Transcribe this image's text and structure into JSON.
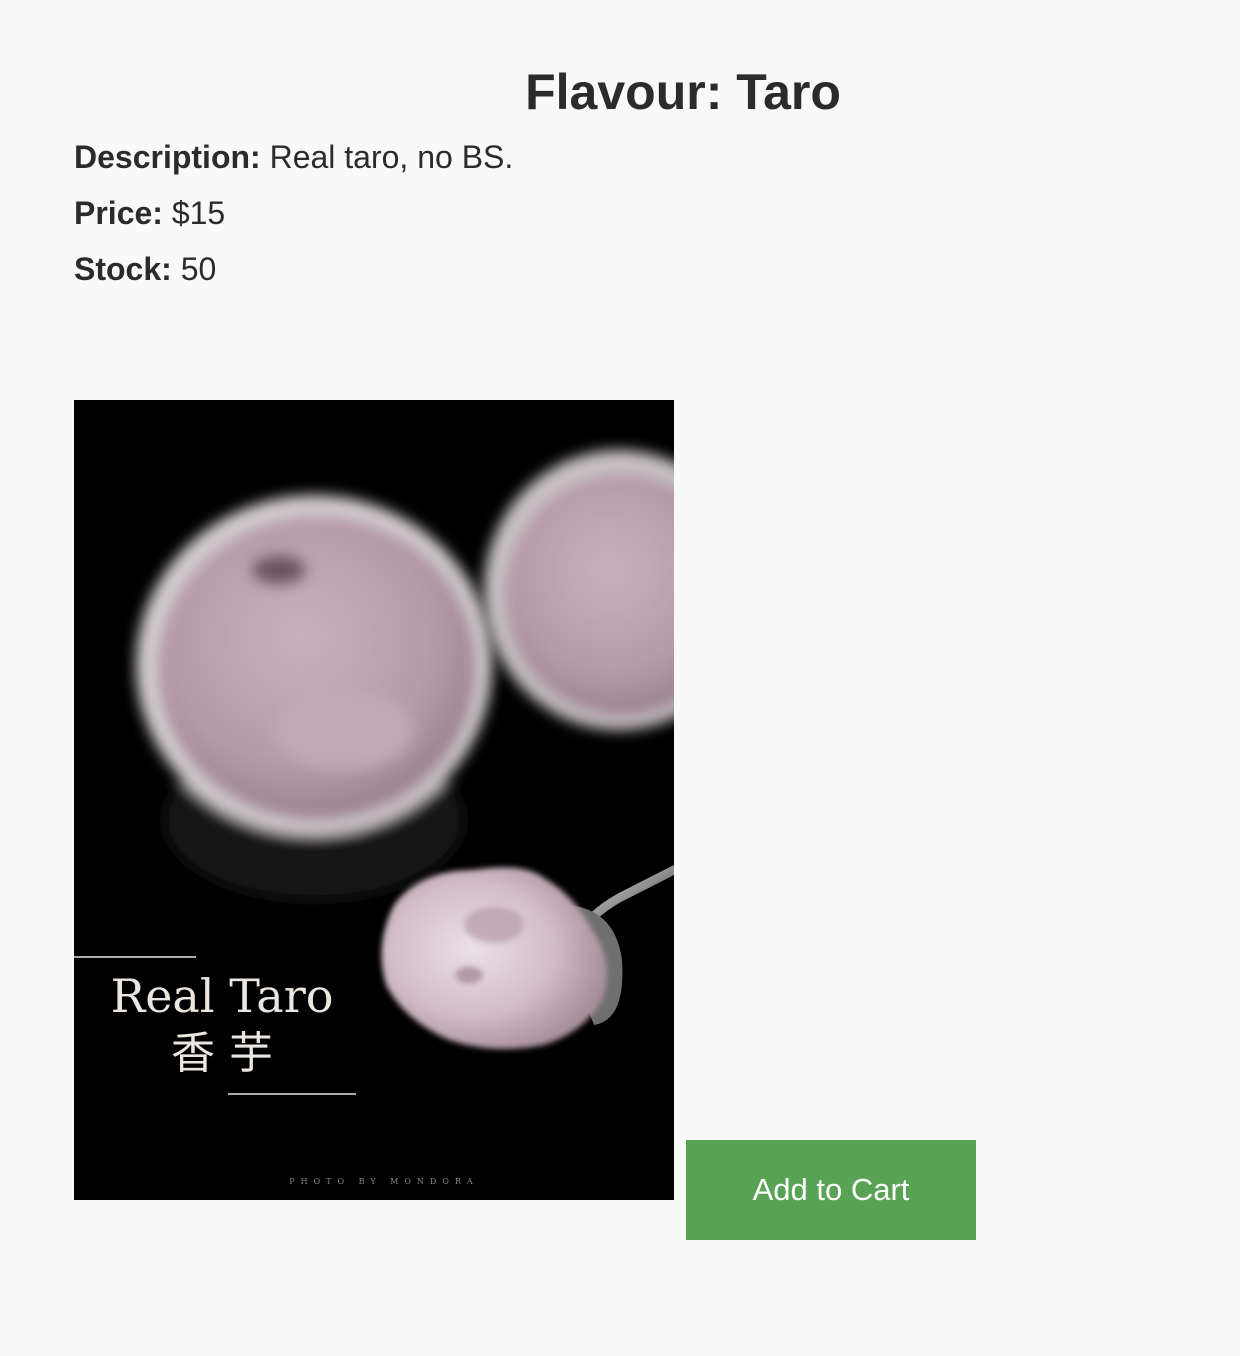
{
  "product": {
    "title": "Flavour: Taro",
    "description_label": "Description:",
    "description": "Real taro, no BS.",
    "price_label": "Price:",
    "price": "$15",
    "stock_label": "Stock:",
    "stock": "50"
  },
  "image": {
    "caption_en": "Real Taro",
    "caption_zh": "香 芋",
    "credit": "PHOTO BY MONDORA",
    "colors": {
      "background": "#000000",
      "ice_cream": "#b89ba8",
      "cup_rim": "#cfc9cc"
    }
  },
  "actions": {
    "add_to_cart_label": "Add to Cart",
    "button_color": "#58a454"
  }
}
